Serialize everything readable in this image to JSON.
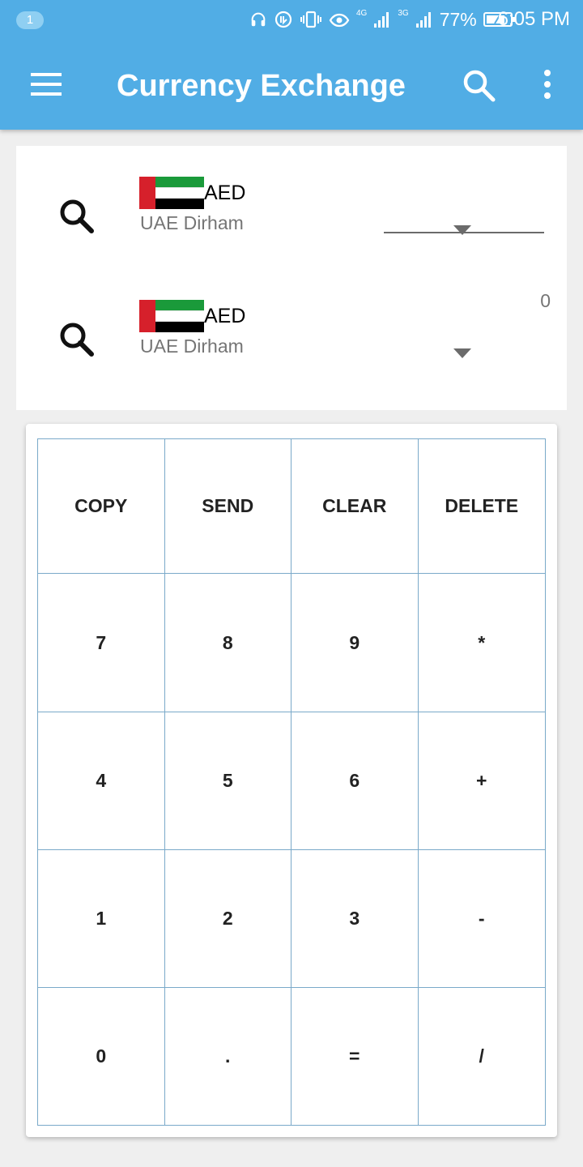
{
  "status_bar": {
    "notification_count": "1",
    "network_4g": "4G",
    "network_3g": "3G",
    "battery": "77%",
    "time": "6:05 PM"
  },
  "app_bar": {
    "title": "Currency Exchange",
    "icons": [
      "menu-icon",
      "search-icon",
      "more-vert-icon"
    ]
  },
  "converter": {
    "from": {
      "code": "AED",
      "name": "UAE Dirham",
      "amount": ""
    },
    "to": {
      "code": "AED",
      "name": "UAE Dirham"
    },
    "result": "0"
  },
  "keypad": {
    "keys": [
      "COPY",
      "SEND",
      "CLEAR",
      "DELETE",
      "7",
      "8",
      "9",
      "*",
      "4",
      "5",
      "6",
      "+",
      "1",
      "2",
      "3",
      "-",
      "0",
      ".",
      "=",
      "/"
    ]
  },
  "colors": {
    "app_bar": "#51ade5",
    "grid_lines": "#7aa9c9",
    "background": "#efefef",
    "flag_red": "#d6202b",
    "flag_green": "#1a9a3a"
  }
}
